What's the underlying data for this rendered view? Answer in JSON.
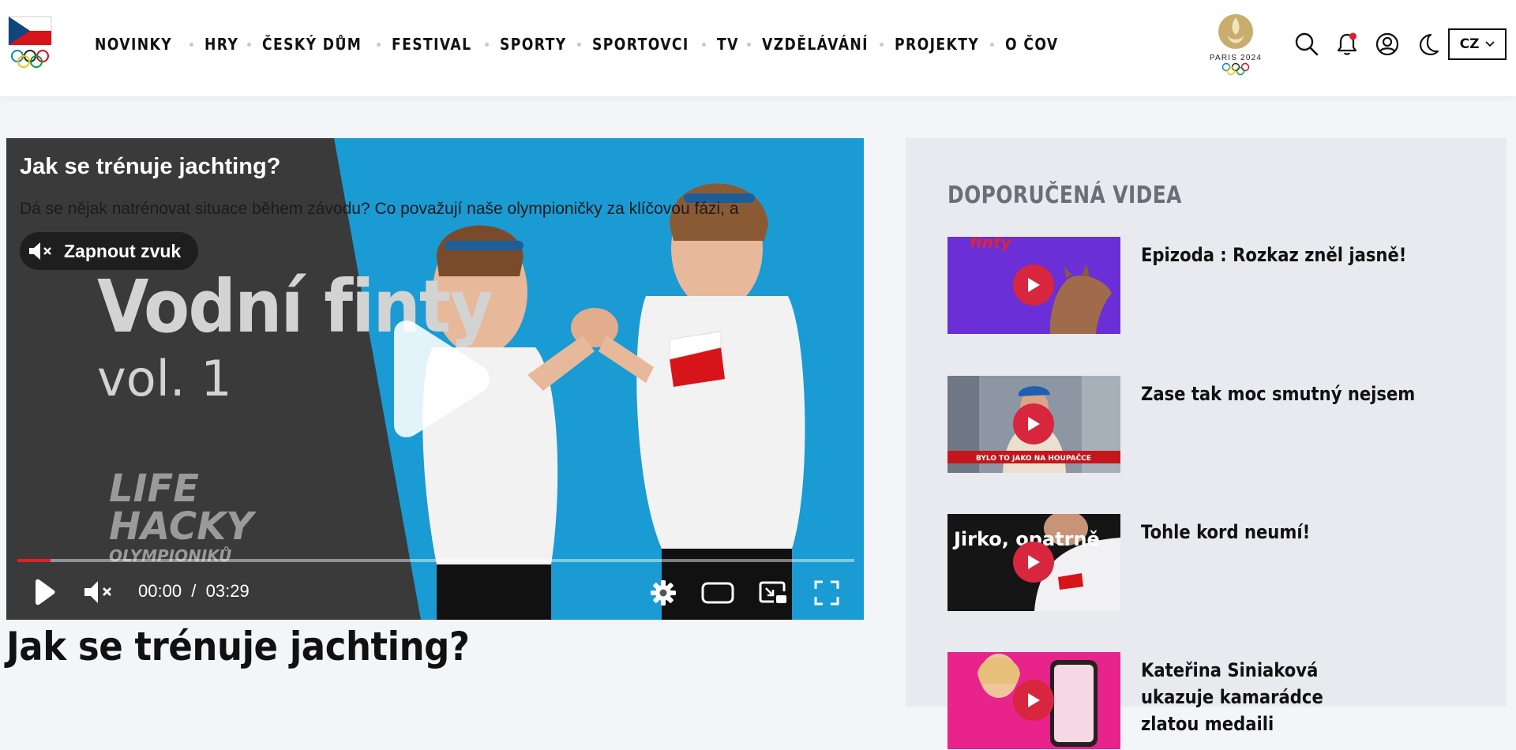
{
  "header": {
    "nav": [
      "NOVINKY",
      "HRY",
      "ČESKÝ DŮM",
      "FESTIVAL",
      "SPORTY",
      "SPORTOVCI",
      "TV",
      "VZDĚLÁVÁNÍ",
      "PROJEKTY",
      "O ČOV"
    ],
    "paris_logo_text": "PARIS 2024",
    "language": "CZ",
    "icons": [
      "search-icon",
      "bell-icon",
      "user-icon",
      "moon-icon",
      "chevron-down-icon"
    ],
    "notification_dot_color": "#e0202a"
  },
  "player": {
    "title": "Jak se trénuje jachting?",
    "description": "Dá se nějak natrénovat situace během závodu? Co považují naše olympioničky za klíčovou fázi, a",
    "mute_label": "Zapnout zvuk",
    "thumb_text_line1": "Vodní finty",
    "thumb_text_line2": "vol. 1",
    "thumb_logo_line1": "LIFE",
    "thumb_logo_line2": "HACKY",
    "thumb_logo_line3": "OLYMPIONIKŮ",
    "current_time": "00:00",
    "time_separator": "/",
    "duration": "03:29",
    "progress": 0.003,
    "progress_color": "#e0202a"
  },
  "article": {
    "title": "Jak se trénuje jachting?"
  },
  "sidebar": {
    "heading": "DOPORUČENÁ VIDEA",
    "videos": [
      {
        "title": "Epizoda : Rozkaz zněl jasně!",
        "thumb_text": "finty"
      },
      {
        "title": "Zase tak moc smutný nejsem",
        "thumb_text": "BYLO TO JAKO NA HOUPAČCE"
      },
      {
        "title": "Tohle kord neumí!",
        "thumb_text": "Jirko, opatrně"
      },
      {
        "title": "Kateřina Siniaková ukazuje kamarádce zlatou medaili",
        "thumb_text": ""
      }
    ]
  },
  "colors": {
    "accent_red": "#d7263d",
    "player_bg_blue": "#1a9bd4",
    "sidebar_bg": "#e9eaef"
  }
}
